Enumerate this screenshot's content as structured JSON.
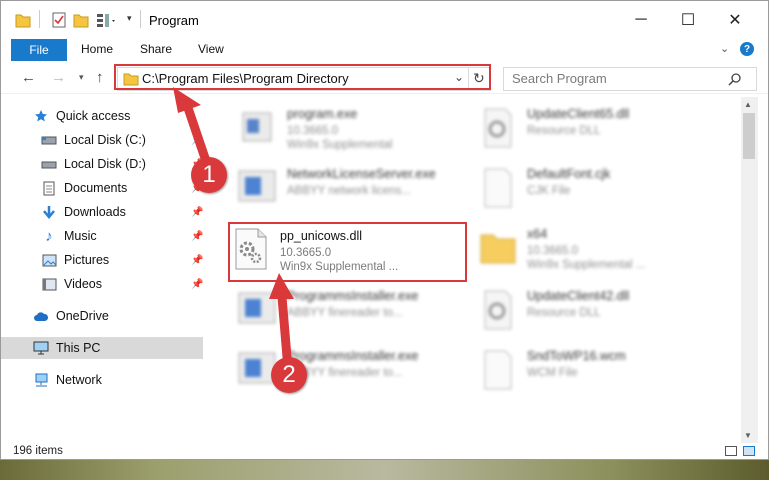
{
  "window": {
    "title": "Program",
    "controls": {
      "minimize": "─",
      "maximize": "☐",
      "close": "✕"
    }
  },
  "ribbon": {
    "file": "File",
    "tabs": [
      "Home",
      "Share",
      "View"
    ],
    "help": "?"
  },
  "address": {
    "path": "C:\\Program Files\\Program Directory",
    "search_placeholder": "Search Program"
  },
  "sidebar": {
    "items": [
      {
        "label": "Quick access",
        "icon": "star-icon",
        "pinned": false
      },
      {
        "label": "Local Disk (C:)",
        "icon": "drive-icon",
        "pinned": true
      },
      {
        "label": "Local Disk (D:)",
        "icon": "drive-icon",
        "pinned": true
      },
      {
        "label": "Documents",
        "icon": "documents-icon",
        "pinned": true
      },
      {
        "label": "Downloads",
        "icon": "download-arrow-icon",
        "pinned": true
      },
      {
        "label": "Music",
        "icon": "music-note-icon",
        "pinned": true
      },
      {
        "label": "Pictures",
        "icon": "pictures-icon",
        "pinned": true
      },
      {
        "label": "Videos",
        "icon": "videos-icon",
        "pinned": true
      },
      {
        "label": "OneDrive",
        "icon": "cloud-icon",
        "pinned": false
      },
      {
        "label": "This PC",
        "icon": "monitor-icon",
        "pinned": false,
        "selected": true
      },
      {
        "label": "Network",
        "icon": "network-icon",
        "pinned": false
      }
    ]
  },
  "files": [
    {
      "name": "program.exe",
      "line2": "10.3665.0",
      "line3": "Win9x Supplemental",
      "type": "exe",
      "blurred": true
    },
    {
      "name": "UpdateClient65.dll",
      "line2": "Resource DLL",
      "line3": "",
      "type": "dll",
      "blurred": true
    },
    {
      "name": "NetworkLicenseServer.exe",
      "line2": "ABBYY network licens...",
      "line3": "",
      "type": "exe",
      "blurred": true
    },
    {
      "name": "DefaultFont.cjk",
      "line2": "CJK File",
      "line3": "",
      "type": "file",
      "blurred": true
    },
    {
      "name": "pp_unicows.dll",
      "line2": "10.3665.0",
      "line3": "Win9x Supplemental ...",
      "type": "dll",
      "blurred": false
    },
    {
      "name": "x64",
      "line2": "10.3665.0",
      "line3": "Win9x Supplemental ...",
      "type": "folder",
      "blurred": true
    },
    {
      "name": "ProgrammsInstaller.exe",
      "line2": "ABBYY finereader to...",
      "line3": "",
      "type": "exe",
      "blurred": true
    },
    {
      "name": "UpdateClient42.dll",
      "line2": "Resource DLL",
      "line3": "",
      "type": "dll",
      "blurred": true
    },
    {
      "name": "ProgrammsInstaller.exe",
      "line2": "ABBYY finereader to...",
      "line3": "",
      "type": "exe",
      "blurred": true
    },
    {
      "name": "SndToWP16.wcm",
      "line2": "WCM File",
      "line3": "",
      "type": "file",
      "blurred": true
    }
  ],
  "status": {
    "item_count": "196 items"
  },
  "callouts": [
    "1",
    "2"
  ],
  "colors": {
    "accent": "#1979ca",
    "highlight": "#d9393b"
  }
}
